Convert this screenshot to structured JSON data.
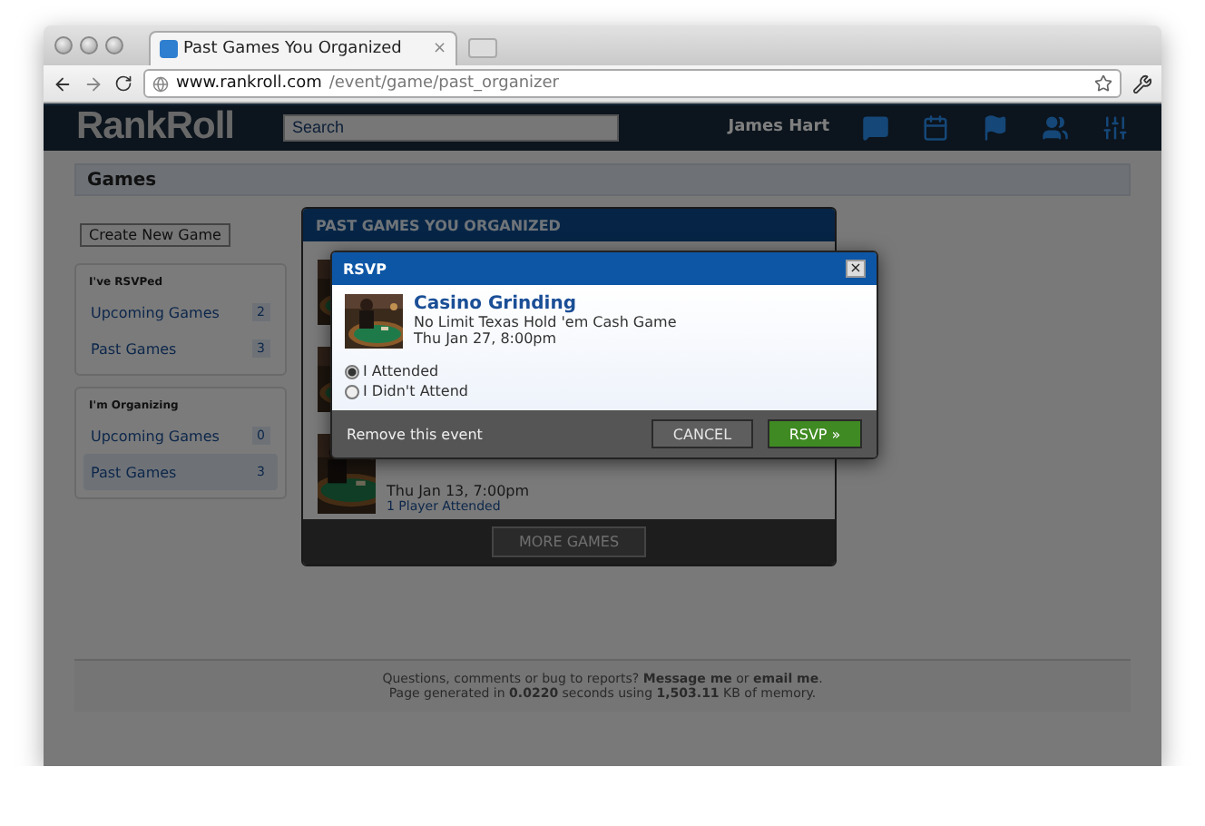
{
  "browser": {
    "tab_title": "Past Games You Organized",
    "tab_close": "×",
    "url_host": "www.rankroll.com",
    "url_path": "/event/game/past_organizer"
  },
  "site": {
    "logo": "RankRoll",
    "search": {
      "placeholder": "Search"
    },
    "user": "James Hart"
  },
  "page_title": "Games",
  "create_button": "Create New Game",
  "sidebar": [
    {
      "title": "I've RSVPed",
      "items": [
        {
          "label": "Upcoming Games",
          "count": "2",
          "selected": false
        },
        {
          "label": "Past Games",
          "count": "3",
          "selected": false
        }
      ]
    },
    {
      "title": "I'm Organizing",
      "items": [
        {
          "label": "Upcoming Games",
          "count": "0",
          "selected": false
        },
        {
          "label": "Past Games",
          "count": "3",
          "selected": true
        }
      ]
    }
  ],
  "panel": {
    "title": "PAST GAMES YOU ORGANIZED",
    "games": [
      {
        "kind": "picture"
      },
      {
        "kind": "picture"
      },
      {
        "kind": "picture",
        "date": "Thu Jan 13, 7:00pm",
        "attendance": "1 Player Attended"
      }
    ],
    "more_button": "MORE GAMES"
  },
  "footer": {
    "line_1": "Questions, comments or bug to reports? **Message me** or **email me**.",
    "line_2": "Page generated in **0.0220** seconds using **1,503.11** KB of memory."
  },
  "modal": {
    "title": "RSVP",
    "close": "×",
    "event": {
      "kind": "picture",
      "name": "Casino Grinding",
      "game": "No Limit Texas Hold 'em Cash Game",
      "date": "Thu Jan 27, 8:00pm"
    },
    "options": [
      {
        "label": "I Attended",
        "selected": true
      },
      {
        "label": "I Didn't Attend",
        "selected": false
      }
    ],
    "remove_link": "Remove this event",
    "cancel_button": "CANCEL",
    "submit_button": "RSVP »"
  }
}
